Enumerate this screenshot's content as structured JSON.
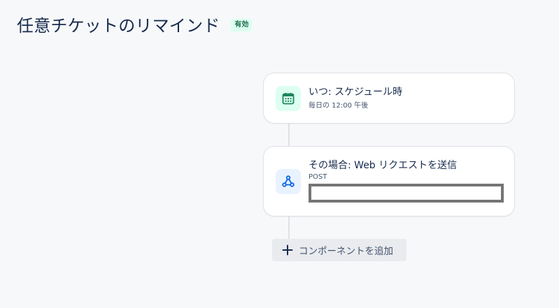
{
  "header": {
    "title": "任意チケットのリマインド",
    "status_badge": "有効"
  },
  "trigger_card": {
    "icon": "calendar-icon",
    "title": "いつ: スケジュール時",
    "subtitle": "毎日の 12:00 午後",
    "accent_color": "#1f845a",
    "icon_bg": "#dcfff1"
  },
  "action_card": {
    "icon": "webhook-icon",
    "title": "その場合: Web リクエストを送信",
    "subtitle": "POST",
    "url": "",
    "accent_color": "#0c66e4",
    "icon_bg": "#e9f2ff"
  },
  "add_component": {
    "label": "コンポーネントを追加",
    "icon": "plus-icon"
  }
}
